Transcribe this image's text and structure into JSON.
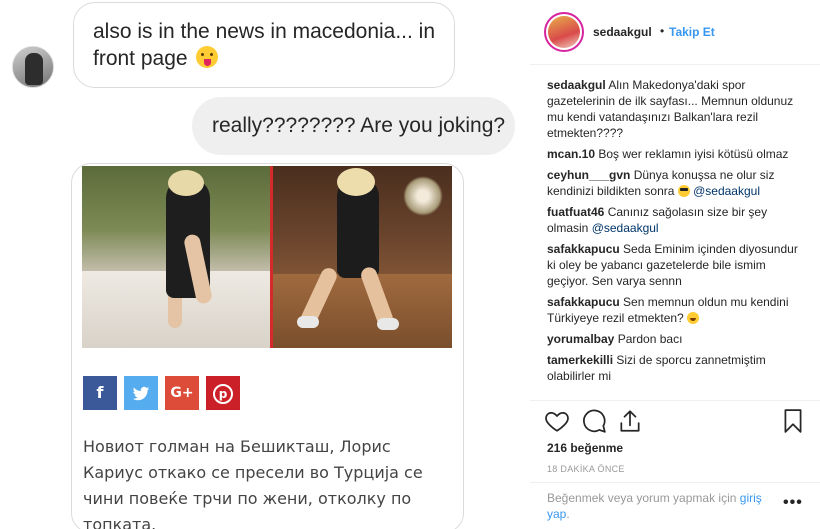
{
  "chat": {
    "incoming_message": "also is in the news in macedonia... in front page",
    "outgoing_message": "really????????  Are you joking?",
    "shared_article": {
      "share_buttons": [
        {
          "icon": "facebook-icon",
          "label": "f"
        },
        {
          "icon": "twitter-icon",
          "label": "t"
        },
        {
          "icon": "google-plus-icon",
          "label": "G+"
        },
        {
          "icon": "pinterest-icon",
          "label": "p"
        }
      ],
      "text": "Новиот голман на Бешикташ, Лорис Кариус откако се пресели во Турција се чини повеќе трчи по жени, отколку по топката."
    }
  },
  "post": {
    "username": "sedaakgul",
    "separator": "•",
    "follow_label": "Takip Et",
    "comments": [
      {
        "user": "sedaakgul",
        "text": "Alın Makedonya'daki spor gazetelerinin de ilk sayfası... Memnun oldunuz mu kendi vatandaşınızı Balkan'lara rezil etmekten????"
      },
      {
        "user": "mcan.10",
        "text": "Boş wer reklamın iyisi kötüsü olmaz"
      },
      {
        "user": "ceyhun___gvn",
        "text": "Dünya konuşsa ne olur siz kendinizi bildikten sonra",
        "mention": "@sedaakgul"
      },
      {
        "user": "fuatfuat46",
        "text": "Canınız sağolasın size bir şey olmasin",
        "mention": "@sedaakgul"
      },
      {
        "user": "safakkapucu",
        "text": "Seda Eminim içinden diyosundur ki oley be yabancı gazetelerde bile ismim geçiyor. Sen varya sennn"
      },
      {
        "user": "safakkapucu",
        "text": "Sen memnun oldun mu kendini Türkiyeye rezil etmekten?"
      },
      {
        "user": "yorumalbay",
        "text": "Pardon bacı"
      },
      {
        "user": "tamerkekilli",
        "text": "Sizi de sporcu zannetmiştim olabilirler mi"
      }
    ],
    "likes": "216 beğenme",
    "time": "18 DAKİKA ÖNCE",
    "login_prompt": "Beğenmek veya yorum yapmak için",
    "login_link": "giriş yap",
    "login_suffix": ".",
    "more": "•••"
  },
  "colors": {
    "link_blue": "#3897f0",
    "mention_blue": "#003569",
    "facebook": "#3b5998",
    "twitter": "#55acee",
    "google_plus": "#dd4b39",
    "pinterest": "#cb2027"
  }
}
